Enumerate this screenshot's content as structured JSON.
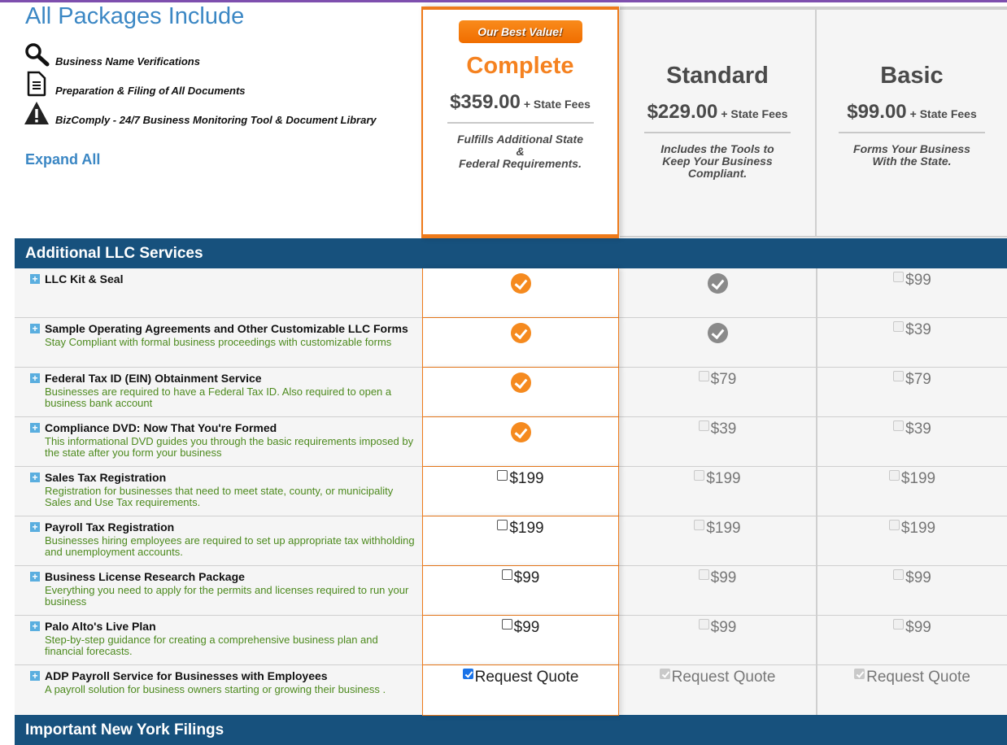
{
  "intro": {
    "title": "All Packages Include",
    "features": [
      {
        "icon": "magnifier-icon",
        "label": "Business Name Verifications"
      },
      {
        "icon": "document-icon",
        "label": "Preparation & Filing of All Documents"
      },
      {
        "icon": "warning-icon",
        "label": "BizComply - 24/7 Business Monitoring Tool & Document Library"
      }
    ],
    "expand_all": "Expand All"
  },
  "packages": {
    "complete": {
      "badge": "Our Best Value!",
      "name": "Complete",
      "price": "$359.00",
      "fees": "+ State Fees",
      "desc_line1": "Fulfills Additional State",
      "desc_line2": "&",
      "desc_line3": "Federal Requirements."
    },
    "standard": {
      "name": "Standard",
      "price": "$229.00",
      "fees": "+ State Fees",
      "desc": "Includes the Tools to Keep Your Business Compliant."
    },
    "basic": {
      "name": "Basic",
      "price": "$99.00",
      "fees": "+ State Fees",
      "desc": "Forms Your Business With the State."
    }
  },
  "sections": {
    "additional": "Additional LLC Services",
    "new_york": "Important New York Filings"
  },
  "services": [
    {
      "name": "LLC Kit & Seal",
      "desc": "",
      "complete": {
        "type": "included"
      },
      "standard": {
        "type": "included"
      },
      "basic": {
        "type": "option",
        "label": "$99",
        "checked": false
      }
    },
    {
      "name": "Sample Operating Agreements and Other Customizable LLC Forms",
      "desc": "Stay Compliant with formal business proceedings with customizable forms",
      "complete": {
        "type": "included"
      },
      "standard": {
        "type": "included"
      },
      "basic": {
        "type": "option",
        "label": "$39",
        "checked": false
      }
    },
    {
      "name": "Federal Tax ID (EIN) Obtainment Service",
      "desc": "Businesses are required to have a Federal Tax ID. Also required to open a business bank account",
      "complete": {
        "type": "included"
      },
      "standard": {
        "type": "option",
        "label": "$79",
        "checked": false
      },
      "basic": {
        "type": "option",
        "label": "$79",
        "checked": false
      }
    },
    {
      "name": "Compliance DVD: Now That You're Formed",
      "desc": "This informational DVD guides you through the basic requirements imposed by the state after you form your business",
      "complete": {
        "type": "included"
      },
      "standard": {
        "type": "option",
        "label": "$39",
        "checked": false
      },
      "basic": {
        "type": "option",
        "label": "$39",
        "checked": false
      }
    },
    {
      "name": "Sales Tax Registration",
      "desc": "Registration for businesses that need to meet state, county, or municipality Sales and Use Tax requirements.",
      "complete": {
        "type": "option",
        "label": "$199",
        "checked": false
      },
      "standard": {
        "type": "option",
        "label": "$199",
        "checked": false
      },
      "basic": {
        "type": "option",
        "label": "$199",
        "checked": false
      }
    },
    {
      "name": "Payroll Tax Registration",
      "desc": "Businesses hiring employees are required to set up appropriate tax withholding and unemployment accounts.",
      "complete": {
        "type": "option",
        "label": "$199",
        "checked": false
      },
      "standard": {
        "type": "option",
        "label": "$199",
        "checked": false
      },
      "basic": {
        "type": "option",
        "label": "$199",
        "checked": false
      }
    },
    {
      "name": "Business License Research Package",
      "desc": "Everything you need to apply for the permits and licenses required to run your business",
      "complete": {
        "type": "option",
        "label": "$99",
        "checked": false
      },
      "standard": {
        "type": "option",
        "label": "$99",
        "checked": false
      },
      "basic": {
        "type": "option",
        "label": "$99",
        "checked": false
      }
    },
    {
      "name": "Palo Alto's Live Plan",
      "desc": "Step-by-step guidance for creating a comprehensive business plan and financial forecasts.",
      "complete": {
        "type": "option",
        "label": "$99",
        "checked": false
      },
      "standard": {
        "type": "option",
        "label": "$99",
        "checked": false
      },
      "basic": {
        "type": "option",
        "label": "$99",
        "checked": false
      }
    },
    {
      "name": "ADP Payroll Service for Businesses with Employees",
      "desc": "A payroll solution for business owners starting or growing their business .",
      "complete": {
        "type": "option",
        "label": "Request Quote",
        "checked": true
      },
      "standard": {
        "type": "option",
        "label": "Request Quote",
        "checked": true
      },
      "basic": {
        "type": "option",
        "label": "Request Quote",
        "checked": true
      }
    }
  ],
  "colors": {
    "accent_orange": "#f58220",
    "section_blue": "#17517d",
    "link_blue": "#3b87c4",
    "desc_green": "#4d8a1e"
  }
}
